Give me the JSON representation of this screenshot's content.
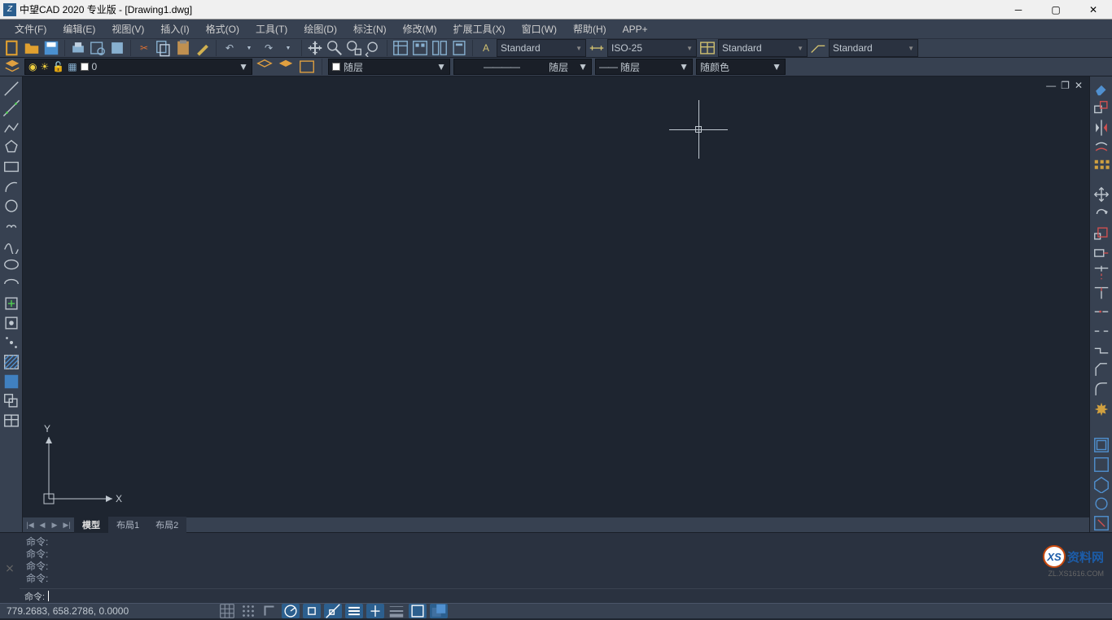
{
  "title": "中望CAD 2020 专业版 - [Drawing1.dwg]",
  "menu": [
    "文件(F)",
    "编辑(E)",
    "视图(V)",
    "插入(I)",
    "格式(O)",
    "工具(T)",
    "绘图(D)",
    "标注(N)",
    "修改(M)",
    "扩展工具(X)",
    "窗口(W)",
    "帮助(H)",
    "APP+"
  ],
  "toolbar1": {
    "textStyle": "Standard",
    "dimStyle": "ISO-25",
    "tableStyle": "Standard",
    "leaderStyle": "Standard"
  },
  "layerbar": {
    "layerName": "0",
    "lineColor": "随层",
    "lineType": "随层",
    "lineWeight": "随层",
    "plotStyle": "随颜色"
  },
  "tabs": {
    "model": "模型",
    "layout1": "布局1",
    "layout2": "布局2"
  },
  "cmd": {
    "history": [
      "命令:",
      "命令:",
      "命令:",
      "命令:"
    ],
    "prompt": "命令:"
  },
  "status": {
    "coords": "779.2683, 658.2786, 0.0000"
  },
  "watermark": {
    "brand": "XS",
    "text": "资料网",
    "url": "ZL.XS1616.COM"
  }
}
